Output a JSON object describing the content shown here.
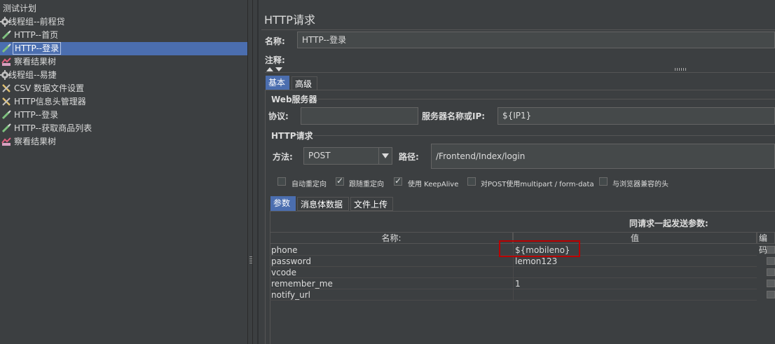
{
  "tree": {
    "items": [
      {
        "label": "测试计划",
        "icon": "test-plan-icon"
      },
      {
        "label": "线程组--前程贷",
        "icon": "thread-group-icon"
      },
      {
        "label": "HTTP--首页",
        "icon": "http-sampler-icon"
      },
      {
        "label": "HTTP--登录",
        "icon": "http-sampler-icon",
        "selected": true
      },
      {
        "label": "察看结果树",
        "icon": "result-tree-icon"
      },
      {
        "label": "线程组--易捷",
        "icon": "thread-group-icon"
      },
      {
        "label": "CSV 数据文件设置",
        "icon": "config-element-icon"
      },
      {
        "label": "HTTP信息头管理器",
        "icon": "config-element-icon"
      },
      {
        "label": "HTTP--登录",
        "icon": "http-sampler-icon"
      },
      {
        "label": "HTTP--获取商品列表",
        "icon": "http-sampler-icon"
      },
      {
        "label": "察看结果树",
        "icon": "result-tree-icon"
      }
    ]
  },
  "panel": {
    "title": "HTTP请求",
    "name_label": "名称:",
    "name_value": "HTTP--登录",
    "comment_label": "注释:",
    "tabs": [
      "基本",
      "高级"
    ],
    "web_server_section": "Web服务器",
    "protocol_label": "协议:",
    "protocol_value": "",
    "server_label": "服务器名称或IP:",
    "server_value": "${IP1}",
    "http_request_section": "HTTP请求",
    "method_label": "方法:",
    "method_value": "POST",
    "path_label": "路径:",
    "path_value": "/Frontend/Index/login",
    "options": [
      {
        "label": "自动重定向",
        "checked": false
      },
      {
        "label": "跟随重定向",
        "checked": true
      },
      {
        "label": "使用 KeepAlive",
        "checked": true
      },
      {
        "label": "对POST使用multipart / form-data",
        "checked": false
      },
      {
        "label": "与浏览器兼容的头",
        "checked": false
      }
    ],
    "param_tabs": [
      "参数",
      "消息体数据",
      "文件上传"
    ],
    "params_caption": "同请求一起发送参数:",
    "columns": [
      "名称:",
      "值",
      "编码"
    ],
    "rows": [
      {
        "name": "phone",
        "value": "${mobileno}"
      },
      {
        "name": "password",
        "value": "lemon123"
      },
      {
        "name": "vcode",
        "value": ""
      },
      {
        "name": "remember_me",
        "value": "1"
      },
      {
        "name": "notify_url",
        "value": ""
      }
    ]
  },
  "colors": {
    "background": "#3c3f41",
    "selection": "#4b6eaf",
    "highlight_box": "#b80000"
  }
}
